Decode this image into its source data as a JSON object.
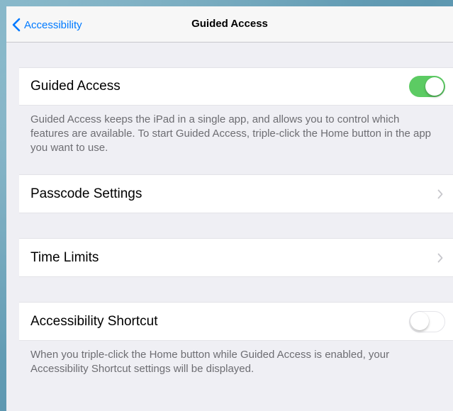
{
  "navbar": {
    "back_label": "Accessibility",
    "title": "Guided Access"
  },
  "settings": {
    "guided_access": {
      "label": "Guided Access",
      "enabled": true
    },
    "guided_access_footer": "Guided Access keeps the iPad in a single app, and allows you to control which features are available. To start Guided Access, triple-click the Home button in the app you want to use.",
    "passcode_settings": {
      "label": "Passcode Settings"
    },
    "time_limits": {
      "label": "Time Limits"
    },
    "accessibility_shortcut": {
      "label": "Accessibility Shortcut",
      "enabled": false
    },
    "accessibility_shortcut_footer": "When you triple-click the Home button while Guided Access is enabled, your Accessibility Shortcut settings will be displayed."
  },
  "colors": {
    "accent": "#007aff",
    "toggle_on": "#5ccb63",
    "background": "#efeff4"
  },
  "icons": {
    "back": "chevron-left-icon",
    "disclosure": "chevron-right-icon"
  }
}
